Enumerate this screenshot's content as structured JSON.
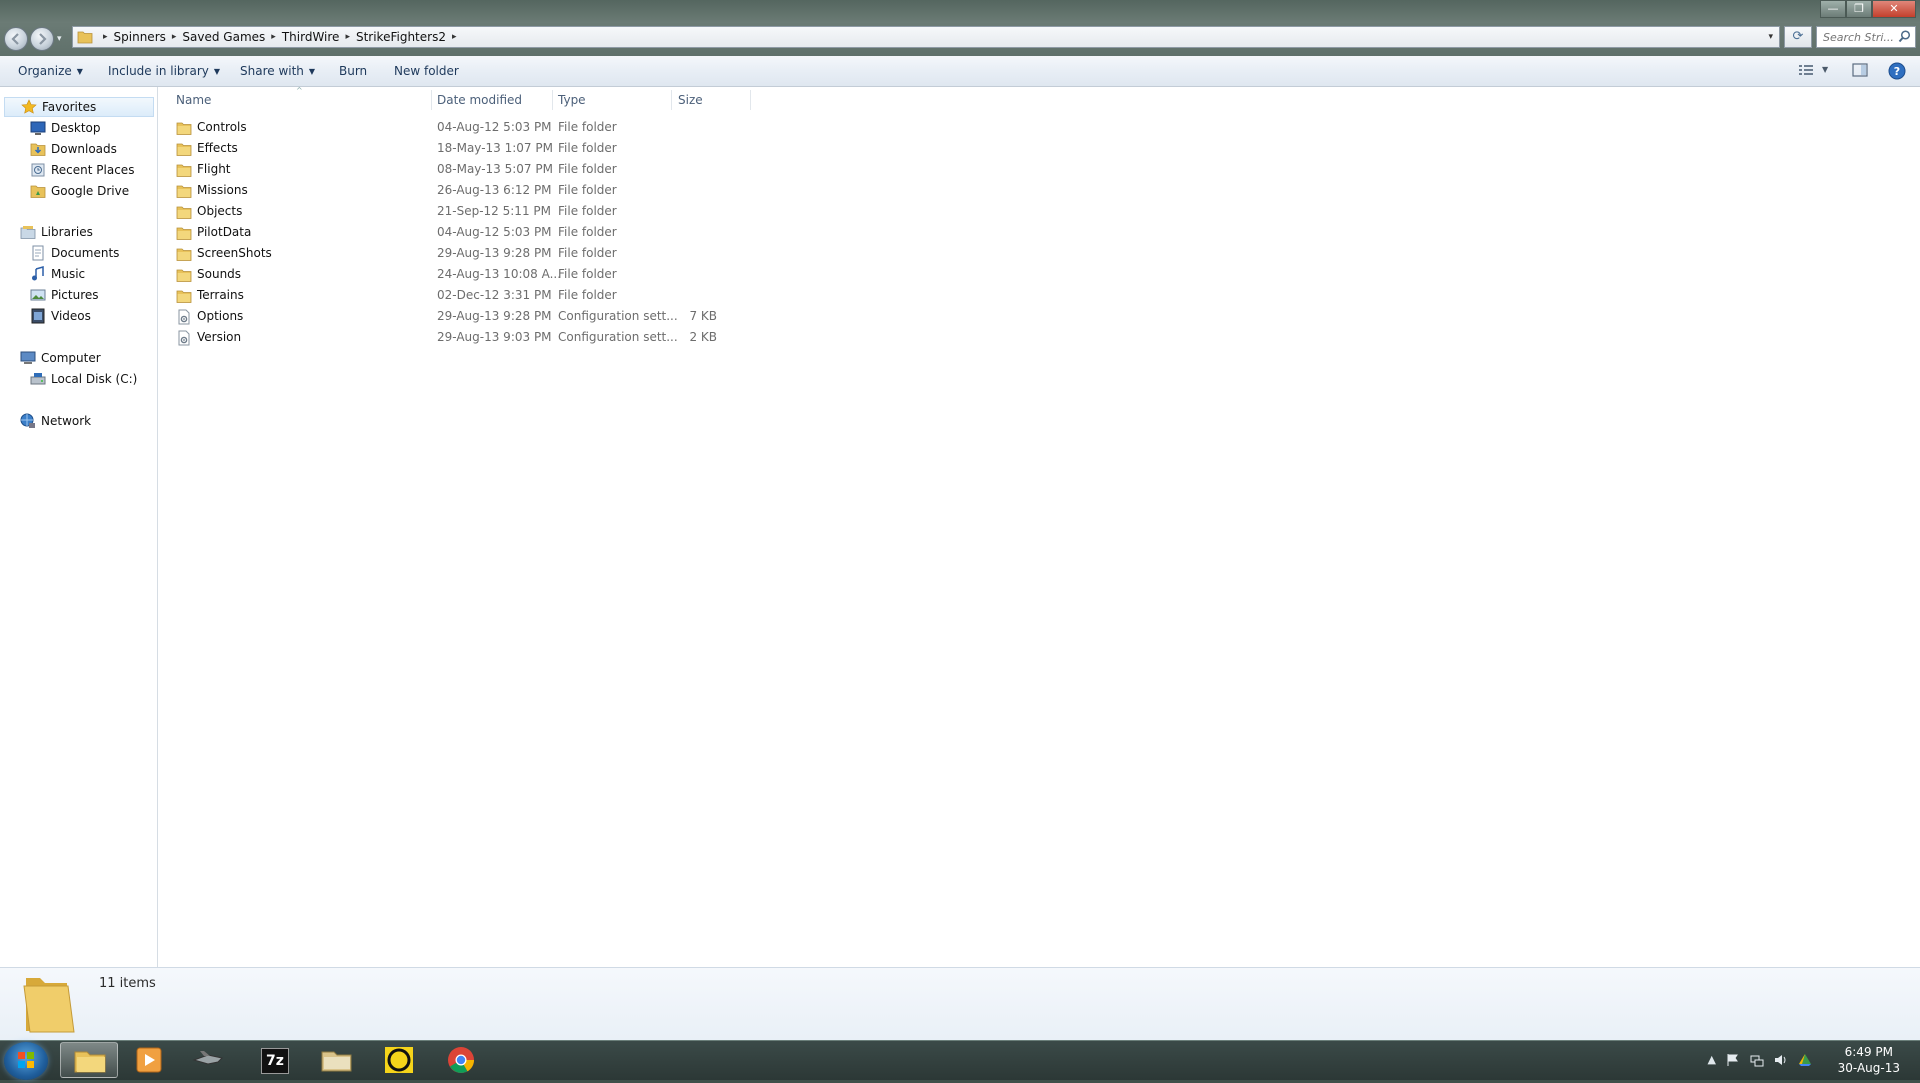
{
  "window": {
    "minimize_label": "—",
    "maximize_label": "❐",
    "close_label": "✕"
  },
  "address": {
    "crumbs": [
      "Spinners",
      "Saved Games",
      "ThirdWire",
      "StrikeFighters2"
    ],
    "separator": "▸",
    "dropdown": "▾",
    "refresh": "⟳"
  },
  "search": {
    "placeholder": "Search Stri..."
  },
  "toolbar": {
    "organize": "Organize",
    "include_in_library": "Include in library",
    "share_with": "Share with",
    "burn": "Burn",
    "new_folder": "New folder",
    "dropdown_arrow": "▼"
  },
  "nav": {
    "favorites": "Favorites",
    "desktop": "Desktop",
    "downloads": "Downloads",
    "recent_places": "Recent Places",
    "google_drive": "Google Drive",
    "libraries": "Libraries",
    "documents": "Documents",
    "music": "Music",
    "pictures": "Pictures",
    "videos": "Videos",
    "computer": "Computer",
    "local_disk": "Local Disk (C:)",
    "network": "Network"
  },
  "columns": {
    "name": "Name",
    "date_modified": "Date modified",
    "type": "Type",
    "size": "Size"
  },
  "files": [
    {
      "name": "Controls",
      "date": "04-Aug-12 5:03 PM",
      "type": "File folder",
      "size": "",
      "icon": "folder-icon"
    },
    {
      "name": "Effects",
      "date": "18-May-13 1:07 PM",
      "type": "File folder",
      "size": "",
      "icon": "folder-icon"
    },
    {
      "name": "Flight",
      "date": "08-May-13 5:07 PM",
      "type": "File folder",
      "size": "",
      "icon": "folder-icon"
    },
    {
      "name": "Missions",
      "date": "26-Aug-13 6:12 PM",
      "type": "File folder",
      "size": "",
      "icon": "folder-icon"
    },
    {
      "name": "Objects",
      "date": "21-Sep-12 5:11 PM",
      "type": "File folder",
      "size": "",
      "icon": "folder-icon"
    },
    {
      "name": "PilotData",
      "date": "04-Aug-12 5:03 PM",
      "type": "File folder",
      "size": "",
      "icon": "folder-icon"
    },
    {
      "name": "ScreenShots",
      "date": "29-Aug-13 9:28 PM",
      "type": "File folder",
      "size": "",
      "icon": "folder-icon"
    },
    {
      "name": "Sounds",
      "date": "24-Aug-13 10:08 A...",
      "type": "File folder",
      "size": "",
      "icon": "folder-icon"
    },
    {
      "name": "Terrains",
      "date": "02-Dec-12 3:31 PM",
      "type": "File folder",
      "size": "",
      "icon": "folder-icon"
    },
    {
      "name": "Options",
      "date": "29-Aug-13 9:28 PM",
      "type": "Configuration sett...",
      "size": "7 KB",
      "icon": "config-file-icon"
    },
    {
      "name": "Version",
      "date": "29-Aug-13 9:03 PM",
      "type": "Configuration sett...",
      "size": "2 KB",
      "icon": "config-file-icon"
    }
  ],
  "details": {
    "item_count": "11 items"
  },
  "taskbar": {
    "time": "6:49 PM",
    "date": "30-Aug-13",
    "seven_zip_label": "7z",
    "show_hidden_icons": "▲"
  },
  "colors": {
    "folder": "#e8c25a",
    "header_text": "#4c607a",
    "meta_text": "#6d6d6d",
    "toolbar_text": "#1e395b"
  }
}
